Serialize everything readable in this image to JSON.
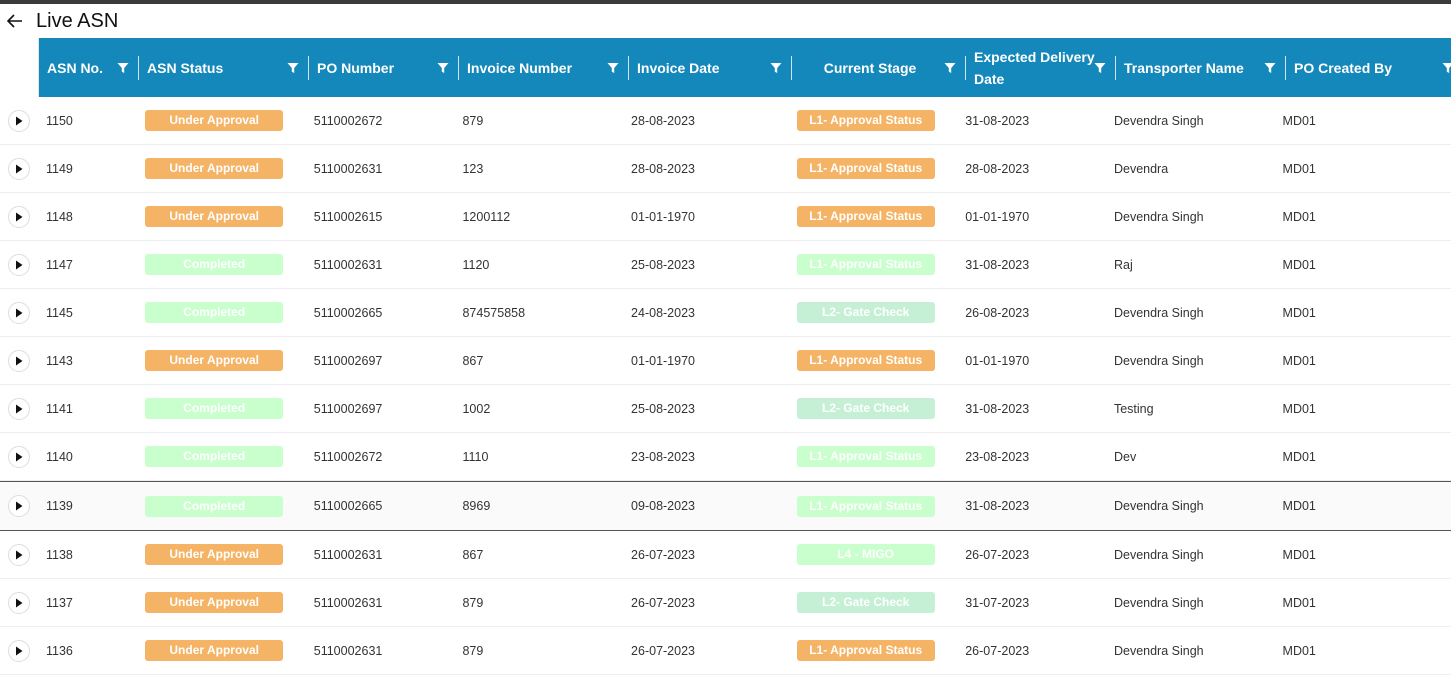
{
  "page": {
    "title": "Live ASN"
  },
  "columns": [
    "ASN No.",
    "ASN Status",
    "PO Number",
    "Invoice Number",
    "Invoice Date",
    "Current Stage",
    "Expected Delivery Date",
    "Transporter Name",
    "PO Created By"
  ],
  "colors": {
    "header_bg": "#1488ba",
    "under_approval": "#f5b365",
    "completed": "#c9ffcc",
    "gate_check": "#c6f0d6",
    "migo": "#c9ffcc"
  },
  "rows": [
    {
      "asn": "1150",
      "status": "Under Approval",
      "status_kind": "orange",
      "po": "5110002672",
      "invoice": "879",
      "inv_date": "28-08-2023",
      "stage": "L1- Approval Status",
      "stage_kind": "orange",
      "exp_date": "31-08-2023",
      "transporter": "Devendra Singh",
      "created_by": "MD01"
    },
    {
      "asn": "1149",
      "status": "Under Approval",
      "status_kind": "orange",
      "po": "5110002631",
      "invoice": "123",
      "inv_date": "28-08-2023",
      "stage": "L1- Approval Status",
      "stage_kind": "orange",
      "exp_date": "28-08-2023",
      "transporter": "Devendra",
      "created_by": "MD01"
    },
    {
      "asn": "1148",
      "status": "Under Approval",
      "status_kind": "orange",
      "po": "5110002615",
      "invoice": "1200112",
      "inv_date": "01-01-1970",
      "stage": "L1- Approval Status",
      "stage_kind": "orange",
      "exp_date": "01-01-1970",
      "transporter": "Devendra Singh",
      "created_by": "MD01"
    },
    {
      "asn": "1147",
      "status": "Completed",
      "status_kind": "green",
      "po": "5110002631",
      "invoice": "1120",
      "inv_date": "25-08-2023",
      "stage": "L1- Approval Status",
      "stage_kind": "green",
      "exp_date": "31-08-2023",
      "transporter": "Raj",
      "created_by": "MD01"
    },
    {
      "asn": "1145",
      "status": "Completed",
      "status_kind": "green",
      "po": "5110002665",
      "invoice": "874575858",
      "inv_date": "24-08-2023",
      "stage": "L2- Gate Check",
      "stage_kind": "teal",
      "exp_date": "26-08-2023",
      "transporter": "Devendra Singh",
      "created_by": "MD01"
    },
    {
      "asn": "1143",
      "status": "Under Approval",
      "status_kind": "orange",
      "po": "5110002697",
      "invoice": "867",
      "inv_date": "01-01-1970",
      "stage": "L1- Approval Status",
      "stage_kind": "orange",
      "exp_date": "01-01-1970",
      "transporter": "Devendra Singh",
      "created_by": "MD01"
    },
    {
      "asn": "1141",
      "status": "Completed",
      "status_kind": "green",
      "po": "5110002697",
      "invoice": "1002",
      "inv_date": "25-08-2023",
      "stage": "L2- Gate Check",
      "stage_kind": "teal",
      "exp_date": "31-08-2023",
      "transporter": "Testing",
      "created_by": "MD01"
    },
    {
      "asn": "1140",
      "status": "Completed",
      "status_kind": "green",
      "po": "5110002672",
      "invoice": "1110",
      "inv_date": "23-08-2023",
      "stage": "L1- Approval Status",
      "stage_kind": "green",
      "exp_date": "23-08-2023",
      "transporter": "Dev",
      "created_by": "MD01"
    },
    {
      "asn": "1139",
      "status": "Completed",
      "status_kind": "green",
      "po": "5110002665",
      "invoice": "8969",
      "inv_date": "09-08-2023",
      "stage": "L1- Approval Status",
      "stage_kind": "green",
      "exp_date": "31-08-2023",
      "transporter": "Devendra Singh",
      "created_by": "MD01",
      "selected": true
    },
    {
      "asn": "1138",
      "status": "Under Approval",
      "status_kind": "orange",
      "po": "5110002631",
      "invoice": "867",
      "inv_date": "26-07-2023",
      "stage": "L4 - MIGO",
      "stage_kind": "green",
      "exp_date": "26-07-2023",
      "transporter": "Devendra Singh",
      "created_by": "MD01"
    },
    {
      "asn": "1137",
      "status": "Under Approval",
      "status_kind": "orange",
      "po": "5110002631",
      "invoice": "879",
      "inv_date": "26-07-2023",
      "stage": "L2- Gate Check",
      "stage_kind": "teal",
      "exp_date": "31-07-2023",
      "transporter": "Devendra Singh",
      "created_by": "MD01"
    },
    {
      "asn": "1136",
      "status": "Under Approval",
      "status_kind": "orange",
      "po": "5110002631",
      "invoice": "879",
      "inv_date": "26-07-2023",
      "stage": "L1- Approval Status",
      "stage_kind": "orange",
      "exp_date": "26-07-2023",
      "transporter": "Devendra Singh",
      "created_by": "MD01"
    }
  ]
}
